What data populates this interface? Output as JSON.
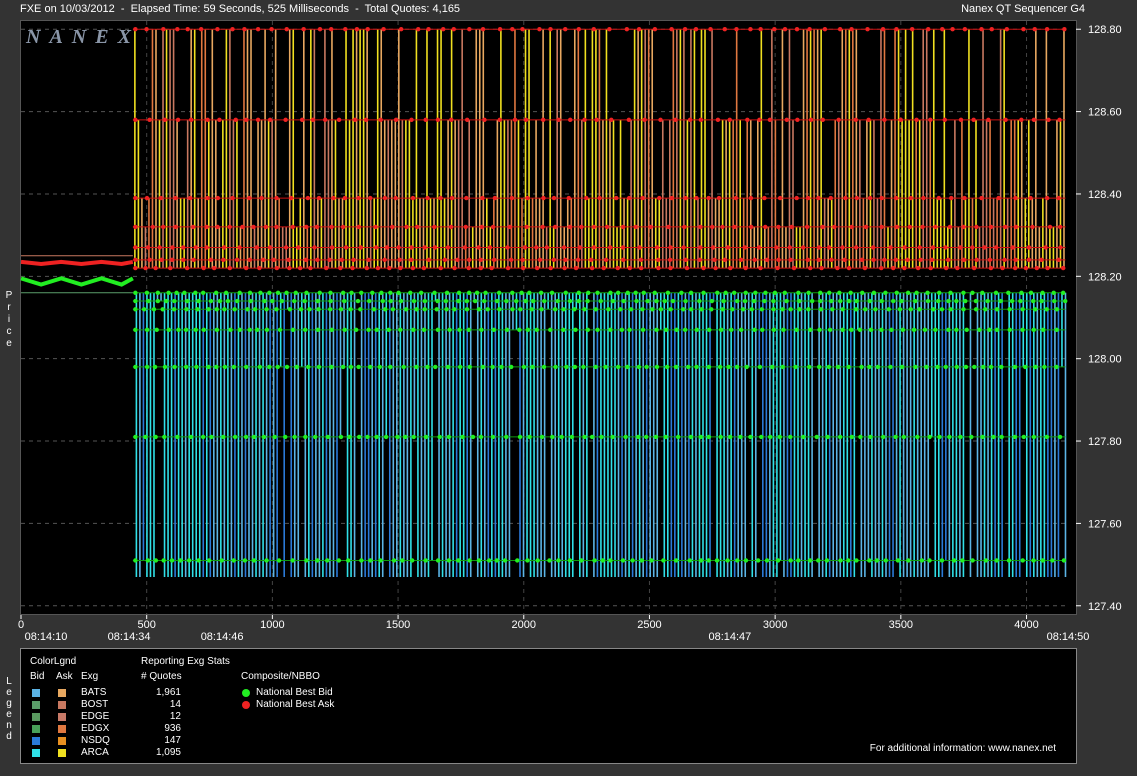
{
  "header": {
    "title_left": "FXE on 10/03/2012  -  Elapsed Time: 59 Seconds, 525 Milliseconds  -  Total Quotes: 4,165",
    "title_right": "Nanex QT Sequencer G4",
    "logo": "NANEX"
  },
  "axis": {
    "y_label": "Price",
    "legend_label": "Legend"
  },
  "chart_data": {
    "type": "line",
    "ylim": [
      127.38,
      128.82
    ],
    "xlim": [
      0,
      4165
    ],
    "y_ticks": [
      "128.80",
      "128.60",
      "128.40",
      "128.20",
      "128.00",
      "127.80",
      "127.60",
      "127.40"
    ],
    "y_tick_values": [
      128.8,
      128.6,
      128.4,
      128.2,
      128.0,
      127.8,
      127.6,
      127.4
    ],
    "x_ticks": [
      "0",
      "500",
      "1000",
      "1500",
      "2000",
      "2500",
      "3000",
      "3500",
      "4000"
    ],
    "x_tick_values": [
      0,
      500,
      1000,
      1500,
      2000,
      2500,
      3000,
      3500,
      4000
    ],
    "time_labels": [
      {
        "x": 0,
        "label": "08:14:10"
      },
      {
        "x": 430,
        "label": "08:14:34"
      },
      {
        "x": 800,
        "label": "08:14:46"
      },
      {
        "x": 2820,
        "label": "08:14:47"
      },
      {
        "x": 4165,
        "label": "08:14:50"
      }
    ],
    "bid_levels": [
      128.16,
      128.14,
      128.12,
      128.07,
      127.98,
      127.81,
      127.51
    ],
    "ask_levels": [
      128.22,
      128.24,
      128.27,
      128.32,
      128.39,
      128.58,
      128.8
    ],
    "bid_low": 127.47,
    "ask_high": 128.8,
    "ask_low_line": 128.22,
    "initial_period": {
      "x_end": 445,
      "bid": 128.19,
      "ask": 128.22
    }
  },
  "legend": {
    "header_colorlgnd": "ColorLgnd",
    "header_bid": "Bid",
    "header_ask": "Ask",
    "header_exg": "Exg",
    "stats_title": "Reporting Exg Stats",
    "stats_col": "# Quotes",
    "nbbo_title": "Composite/NBBO",
    "exchanges": [
      {
        "name": "BATS",
        "quotes": "1,961",
        "bid_color": "#5bb4e5",
        "ask_color": "#e8a860"
      },
      {
        "name": "BOST",
        "quotes": "14",
        "bid_color": "#5b9e6a",
        "ask_color": "#c87860"
      },
      {
        "name": "EDGE",
        "quotes": "12",
        "bid_color": "#5a9a60",
        "ask_color": "#c87a68"
      },
      {
        "name": "EDGX",
        "quotes": "936",
        "bid_color": "#48a058",
        "ask_color": "#e07840"
      },
      {
        "name": "NSDQ",
        "quotes": "147",
        "bid_color": "#2a7ad8",
        "ask_color": "#e89020"
      },
      {
        "name": "ARCA",
        "quotes": "1,095",
        "bid_color": "#30e0e8",
        "ask_color": "#f0e020"
      }
    ],
    "nbbo": [
      {
        "label": "National Best Bid",
        "color": "#22ee22"
      },
      {
        "label": "National Best Ask",
        "color": "#ee2222"
      }
    ],
    "footer": "For additional information: www.nanex.net"
  }
}
